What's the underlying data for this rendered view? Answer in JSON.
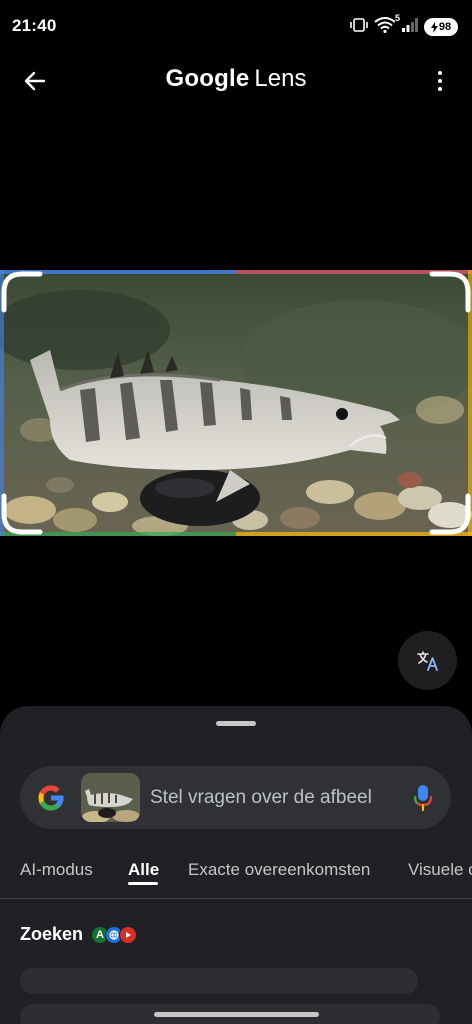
{
  "status_bar": {
    "time": "21:40",
    "network_label": "5",
    "battery_level": "98",
    "icons": [
      "vibrate-icon",
      "wifi-icon",
      "signal-icon",
      "battery-charging-icon"
    ]
  },
  "header": {
    "brand_google": "Google",
    "brand_lens": "Lens",
    "back_icon": "arrow-left-icon",
    "menu_icon": "more-vertical-icon"
  },
  "photo": {
    "subject": "fish-on-gravel-photo",
    "frame_colors": [
      "#4285F4",
      "#EA4335",
      "#FBBC05",
      "#34A853"
    ]
  },
  "translate_button": {
    "icon": "translate-icon"
  },
  "search": {
    "placeholder": "Stel vragen over de afbeel",
    "mic_icon": "microphone-icon"
  },
  "tabs": [
    {
      "label": "AI-modus",
      "active": false
    },
    {
      "label": "Alle",
      "active": true
    },
    {
      "label": "Exacte overeenkomsten",
      "active": false
    },
    {
      "label": "Visuele o",
      "active": false
    }
  ],
  "results": {
    "title": "Zoeken",
    "source_badges": [
      {
        "letter": "A",
        "color": "#137333"
      },
      {
        "letter": "",
        "color": "#1a73e8"
      },
      {
        "letter": "",
        "color": "#d93025"
      }
    ]
  },
  "colors": {
    "background": "#000000",
    "sheet": "#202124",
    "search_box": "#303134",
    "accent_blue": "#4285F4"
  }
}
